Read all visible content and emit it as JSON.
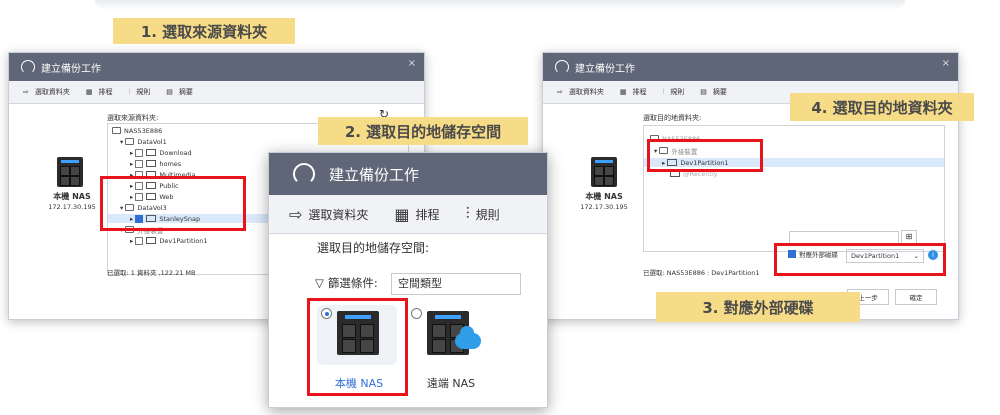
{
  "steps": {
    "step1": "1. 選取來源資料夾",
    "step2": "2. 選取目的地儲存空間",
    "step3": "3. 對應外部硬碟",
    "step4": "4. 選取目的地資料夾"
  },
  "win_left": {
    "title": "建立備份工作",
    "tabs": [
      "選取資料夾",
      "排程",
      "規則",
      "摘要"
    ],
    "section_label": "選取來源資料夾:",
    "refresh_icon": "refresh-icon",
    "device_name": "本機 NAS",
    "device_ip": "172.17.30.195",
    "tree": [
      "NAS53E886",
      "DataVol1",
      "Download",
      "homes",
      "Multimedia",
      "Public",
      "Web",
      "DataVol3",
      "StanleySnap",
      "外接裝置",
      "Dev1Partition1"
    ],
    "selected_summary": "已選取: 1 資料夾 ,122.21 MB"
  },
  "win_mid": {
    "title": "建立備份工作",
    "tabs": [
      "選取資料夾",
      "排程",
      "規則"
    ],
    "section_label": "選取目的地儲存空間:",
    "filter_label": "篩選條件:",
    "filter_value": "空間類型",
    "options": [
      "本機 NAS",
      "遠端 NAS"
    ]
  },
  "win_right": {
    "title": "建立備份工作",
    "tabs": [
      "選取資料夾",
      "排程",
      "規則",
      "摘要"
    ],
    "section_label": "選取目的地資料夾:",
    "device_name": "本機 NAS",
    "device_ip": "172.17.30.195",
    "tree": [
      "NAS53E886",
      "外接裝置",
      "Dev1Partition1",
      "@Recently"
    ],
    "map_checkbox_label": "對應外部磁碟",
    "map_select_value": "Dev1Partition1",
    "selected_summary": "已選取: NAS53E886 : Dev1Partition1",
    "prev_button": "上一步",
    "ok_button": "確定"
  },
  "colors": {
    "label_bg": "#f7dc88",
    "titlebar": "#5f6677",
    "highlight": "#e8141b",
    "selection": "#d9e8fb"
  }
}
